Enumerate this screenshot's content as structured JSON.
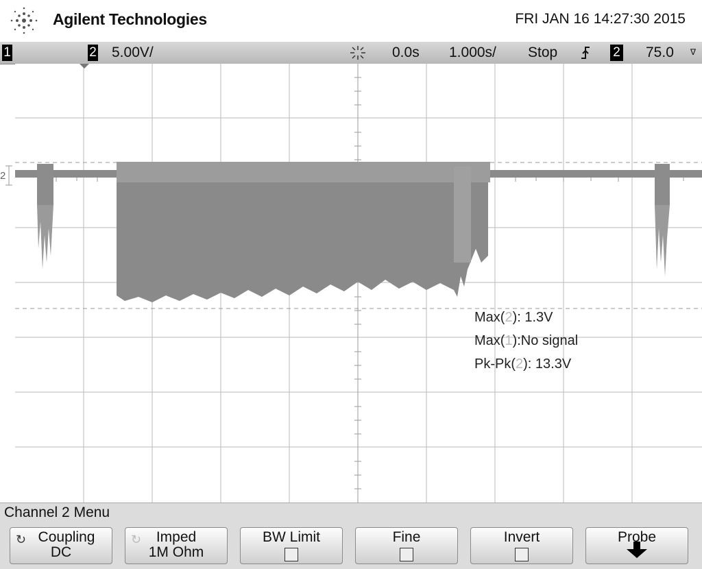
{
  "header": {
    "brand": "Agilent Technologies",
    "datetime": "FRI JAN 16 14:27:30 2015"
  },
  "status": {
    "ch1_label": "1",
    "ch2_label": "2",
    "volts_per_div": "5.00V/",
    "time_offset": "0.0s",
    "time_per_div": "1.000s/",
    "run_state": "Stop",
    "trigger_source": "2",
    "trigger_level": "75.0",
    "icons": [
      "cursor-spark-icon",
      "trigger-edge-icon"
    ]
  },
  "measurements": [
    {
      "label": "Max(",
      "ch": "2",
      "value": "): 1.3V"
    },
    {
      "label": "Max(",
      "ch": "1",
      "value": "):No signal"
    },
    {
      "label": "Pk-Pk(",
      "ch": "2",
      "value": "): 13.3V"
    }
  ],
  "channel_marker": "2",
  "menu": {
    "title": "Channel 2  Menu",
    "softkeys": [
      {
        "line1": "Coupling",
        "line2": "DC"
      },
      {
        "line1": "Imped",
        "line2": "1M Ohm"
      },
      {
        "line1": "BW Limit",
        "line2": ""
      },
      {
        "line1": "Fine",
        "line2": ""
      },
      {
        "line1": "Invert",
        "line2": ""
      },
      {
        "line1": "Probe",
        "line2": ""
      }
    ]
  },
  "colors": {
    "trace": "#7a7a7a",
    "grid": "#b8b8b8",
    "statusbar": "#c8c8c8"
  }
}
